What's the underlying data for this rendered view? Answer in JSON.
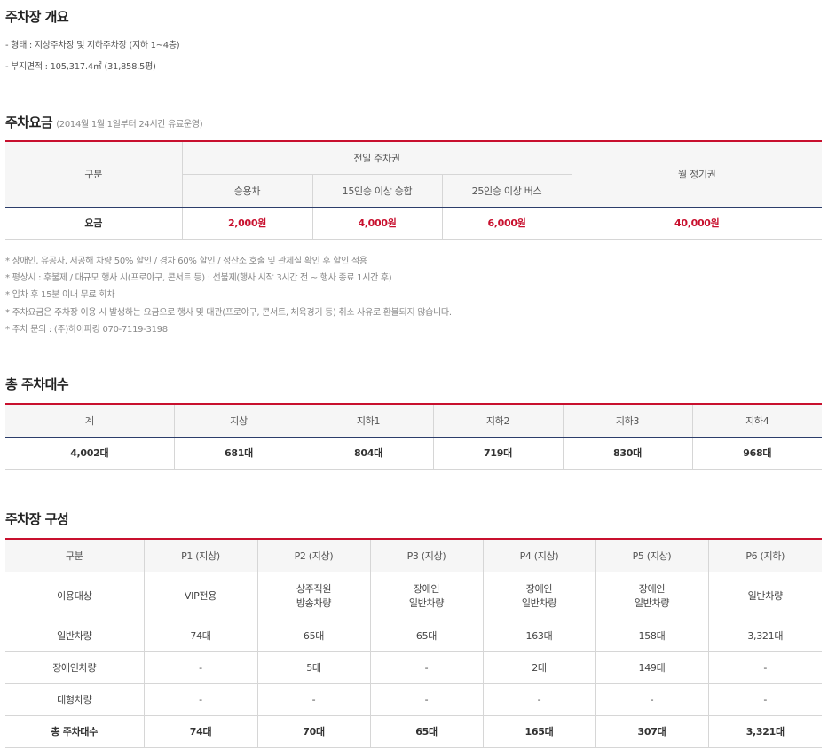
{
  "overview": {
    "title": "주차장 개요",
    "lines": [
      "- 형태 : 지상주차장 및 지하주차장 (지하 1~4층)",
      "- 부지면적 : 105,317.4㎡ (31,858.5평)"
    ]
  },
  "fees": {
    "title": "주차요금",
    "subtitle": "(2014월 1월 1일부터 24시간 유료운영)",
    "header": {
      "category": "구분",
      "day_pass": "전일 주차권",
      "car": "승용차",
      "van15": "15인승 이상 승합",
      "bus25": "25인승 이상 버스",
      "monthly": "월 정기권"
    },
    "row": {
      "label": "요금",
      "car": "2,000원",
      "van15": "4,000원",
      "bus25": "6,000원",
      "monthly": "40,000원"
    },
    "notes": [
      "* 장애인, 유공자, 저공해 차량 50% 할인 / 경차 60% 할인 / 정산소 호출 및 관제실 확인 후 할인 적용",
      "* 평상시 : 후불제 / 대규모 행사 시(프로야구, 콘서트 등) : 선불제(행사 시작 3시간 전 ~ 행사 종료 1시간 후)",
      "* 입차 후 15분 이내 무료 회차",
      "* 주차요금은 주차장 이용 시 발생하는 요금으로 행사 및 대관(프로야구, 콘서트, 체육경기 등) 취소 사유로 환불되지 않습니다.",
      "* 주차 문의 : (주)하이파킹 070-7119-3198"
    ]
  },
  "total": {
    "title": "총 주차대수",
    "headers": [
      "계",
      "지상",
      "지하1",
      "지하2",
      "지하3",
      "지하4"
    ],
    "values": [
      "4,002대",
      "681대",
      "804대",
      "719대",
      "830대",
      "968대"
    ]
  },
  "config": {
    "title": "주차장 구성",
    "headers": [
      "구분",
      "P1 (지상)",
      "P2 (지상)",
      "P3 (지상)",
      "P4 (지상)",
      "P5 (지상)",
      "P6 (지하)"
    ],
    "rows": [
      {
        "label": "이용대상",
        "cells": [
          [
            "VIP전용"
          ],
          [
            "상주직원",
            "방송차량"
          ],
          [
            "장애인",
            "일반차량"
          ],
          [
            "장애인",
            "일반차량"
          ],
          [
            "장애인",
            "일반차량"
          ],
          [
            "일반차량"
          ]
        ]
      },
      {
        "label": "일반차량",
        "cells": [
          [
            "74대"
          ],
          [
            "65대"
          ],
          [
            "65대"
          ],
          [
            "163대"
          ],
          [
            "158대"
          ],
          [
            "3,321대"
          ]
        ]
      },
      {
        "label": "장애인차량",
        "cells": [
          [
            "-"
          ],
          [
            "5대"
          ],
          [
            "-"
          ],
          [
            "2대"
          ],
          [
            "149대"
          ],
          [
            "-"
          ]
        ]
      },
      {
        "label": "대형차량",
        "cells": [
          [
            "-"
          ],
          [
            "-"
          ],
          [
            "-"
          ],
          [
            "-"
          ],
          [
            "-"
          ],
          [
            "-"
          ]
        ]
      },
      {
        "label": "총 주차대수",
        "cells": [
          [
            "74대"
          ],
          [
            "70대"
          ],
          [
            "65대"
          ],
          [
            "165대"
          ],
          [
            "307대"
          ],
          [
            "3,321대"
          ]
        ]
      }
    ]
  },
  "colors": {
    "accent": "#c8102e",
    "header_bottom": "#2c3e6b",
    "header_bg": "#f6f6f6"
  }
}
